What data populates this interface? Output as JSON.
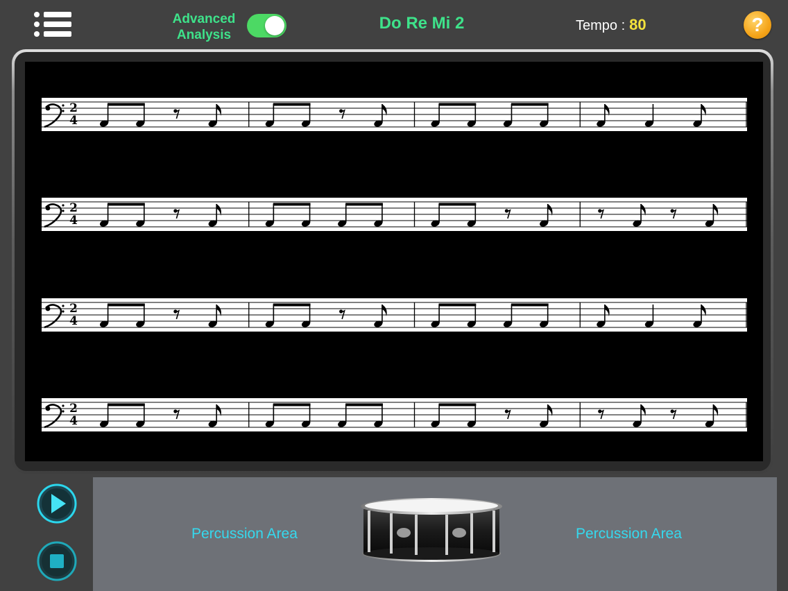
{
  "header": {
    "advanced_label": "Advanced\nAnalysis",
    "advanced_enabled": true,
    "song_title": "Do Re Mi 2",
    "tempo_label": "Tempo :",
    "tempo_value": "80",
    "help_symbol": "?",
    "menu_icon": "list-icon",
    "help_icon": "question-mark-icon"
  },
  "score": {
    "clef": "bass",
    "time_signature": {
      "top": "2",
      "bottom": "4"
    },
    "rows": [
      {
        "measures": [
          [
            "beam8",
            "rest8",
            "n8"
          ],
          [
            "beam8",
            "rest8",
            "n8"
          ],
          [
            "beam8",
            "beam8"
          ],
          [
            "n8",
            "q",
            "n8"
          ]
        ]
      },
      {
        "measures": [
          [
            "beam8",
            "rest8",
            "n8"
          ],
          [
            "beam8",
            "beam8"
          ],
          [
            "beam8",
            "rest8",
            "n8"
          ],
          [
            "rest8",
            "n8",
            "rest8",
            "n8"
          ]
        ]
      },
      {
        "measures": [
          [
            "beam8",
            "rest8",
            "n8"
          ],
          [
            "beam8",
            "rest8",
            "n8"
          ],
          [
            "beam8",
            "beam8"
          ],
          [
            "n8",
            "q",
            "n8"
          ]
        ]
      },
      {
        "measures": [
          [
            "beam8",
            "rest8",
            "n8"
          ],
          [
            "beam8",
            "beam8"
          ],
          [
            "beam8",
            "rest8",
            "n8"
          ],
          [
            "rest8",
            "n8",
            "rest8",
            "n8"
          ]
        ]
      }
    ]
  },
  "controls": {
    "play_icon": "play-icon",
    "stop_icon": "stop-icon"
  },
  "percussion": {
    "left_label": "Percussion Area",
    "right_label": "Percussion Area",
    "drum_icon": "snare-drum-icon"
  },
  "colors": {
    "accent_green": "#3ee28a",
    "tempo_yellow": "#f4e23c",
    "percussion_text": "#35d9ee",
    "toggle_on": "#4cd964"
  }
}
